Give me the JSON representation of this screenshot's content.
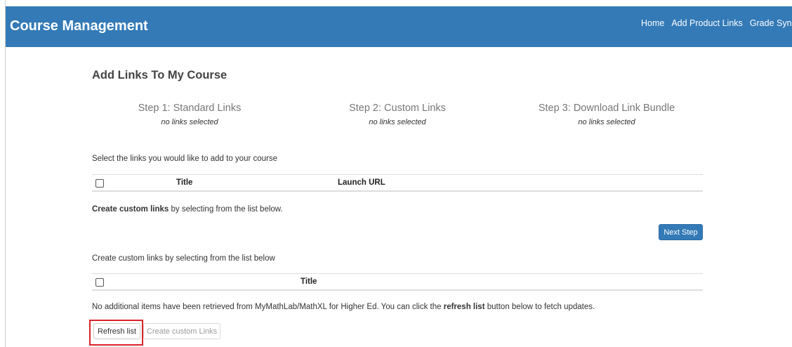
{
  "navbar": {
    "brand": "Course Management",
    "links": [
      "Home",
      "Add Product Links",
      "Grade Syn"
    ]
  },
  "page": {
    "title": "Add Links To My Course"
  },
  "steps": [
    {
      "label": "Step 1: Standard Links",
      "status": "no links selected"
    },
    {
      "label": "Step 2: Custom Links",
      "status": "no links selected"
    },
    {
      "label": "Step 3: Download Link Bundle",
      "status": "no links selected"
    }
  ],
  "standard_links": {
    "instruction": "Select the links you would like to add to your course",
    "columns": [
      "Title",
      "Launch URL"
    ]
  },
  "custom_prompt": {
    "bold": "Create custom links",
    "rest": " by selecting from the list below."
  },
  "next_step_label": "Next Step",
  "custom_links": {
    "instruction": "Create custom links by selecting from the list below",
    "columns": [
      "Title"
    ]
  },
  "notice": {
    "before": "No additional items have been retrieved from MyMathLab/MathXL for Higher Ed. You can click the ",
    "bold": "refresh list",
    "after": " button below to fetch updates."
  },
  "buttons": {
    "refresh": "Refresh list",
    "create_custom": "Create custom Links"
  },
  "colors": {
    "navbar": "#337ab7",
    "highlight": "#d9232a"
  }
}
